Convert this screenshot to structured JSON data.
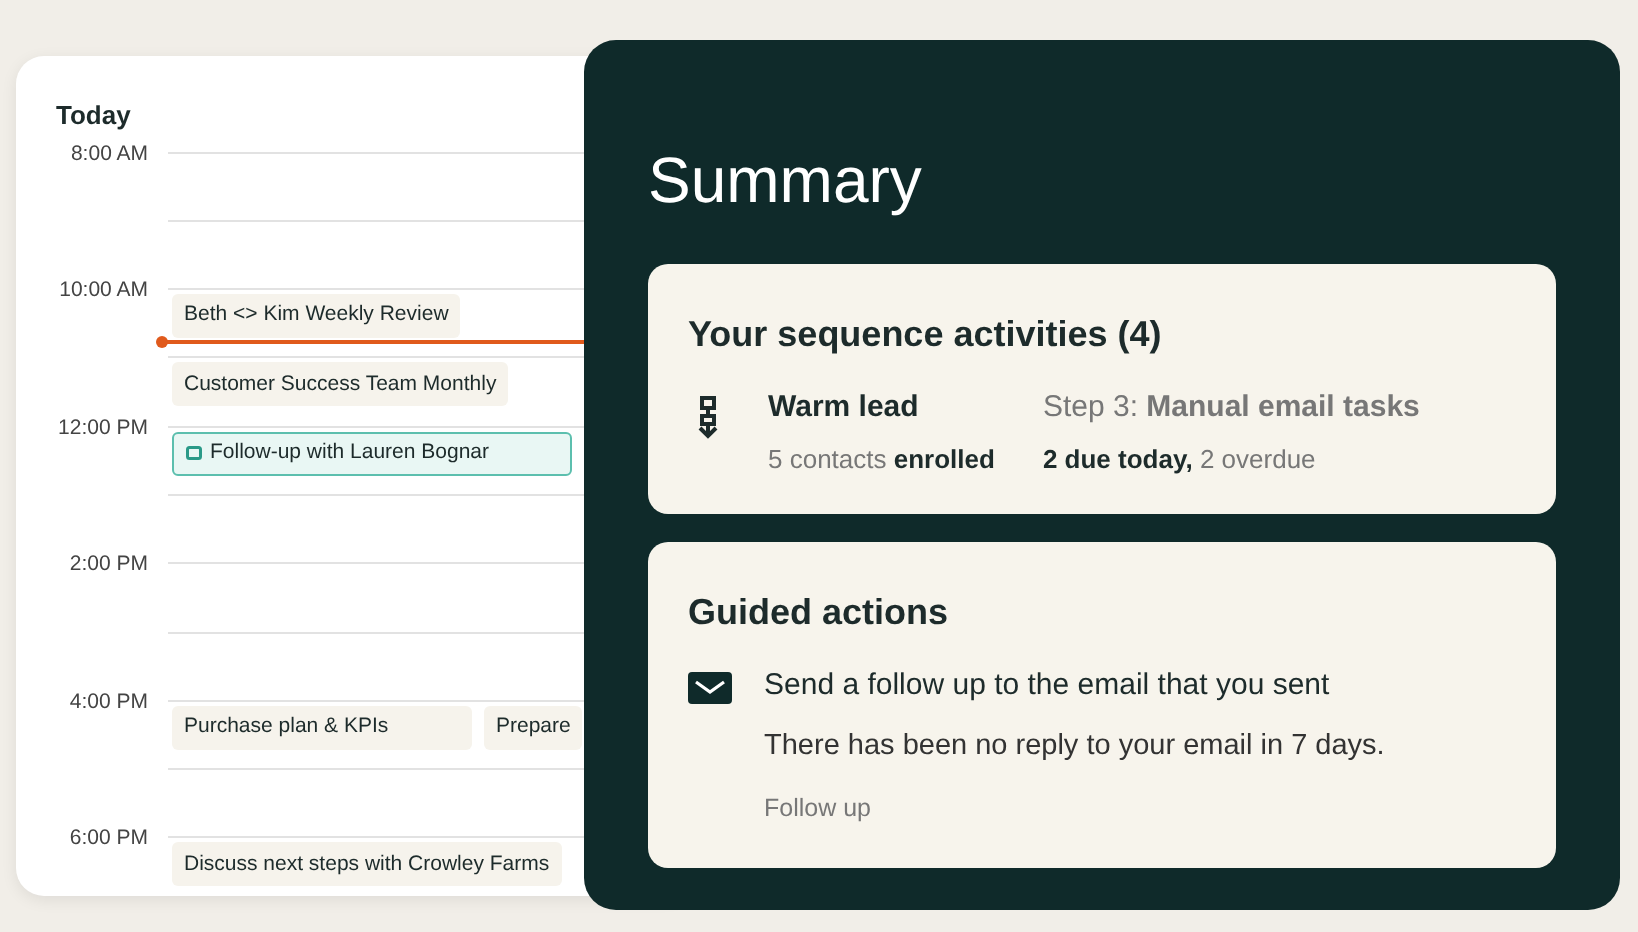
{
  "calendar": {
    "title": "Today",
    "blocks": [
      {
        "time": "8:00 AM"
      },
      {
        "time": "10:00 AM",
        "current_time": true,
        "events": [
          {
            "title": "Beth <> Kim Weekly Review",
            "kind": "meeting"
          }
        ],
        "later_events": [
          {
            "title": "Customer Success Team Monthly",
            "kind": "meeting"
          }
        ]
      },
      {
        "time": "12:00 PM",
        "events": [
          {
            "title": "Follow-up with Lauren Bognar",
            "kind": "task"
          }
        ]
      },
      {
        "time": "2:00 PM"
      },
      {
        "time": "4:00 PM",
        "events": [
          {
            "title": "Purchase plan & KPIs",
            "kind": "meeting"
          },
          {
            "title": "Prepare",
            "kind": "meeting"
          }
        ]
      },
      {
        "time": "6:00 PM",
        "events": [
          {
            "title": "Discuss next steps with Crowley Farms",
            "kind": "meeting"
          }
        ]
      }
    ]
  },
  "summary": {
    "title": "Summary",
    "sequence": {
      "title": "Your sequence activities (4)",
      "name": "Warm lead",
      "enrolled": "5 contacts **enrolled**",
      "step": "Step 3: **Manual email tasks**",
      "due": "**2 due today,** 2 overdue"
    },
    "guided": {
      "title": "Guided actions",
      "action": "Send a follow up to the email that you sent",
      "detail": "There has been no reply to your email in 7 days.",
      "link": "Follow up"
    }
  }
}
